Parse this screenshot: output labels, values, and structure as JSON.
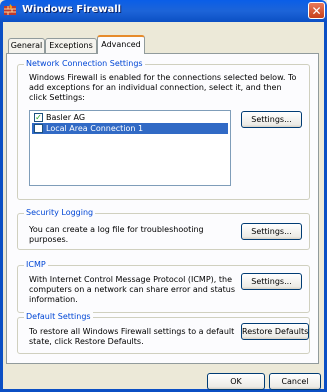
{
  "window": {
    "title": "Windows Firewall",
    "close_glyph": "✕"
  },
  "tabs": [
    {
      "label": "General"
    },
    {
      "label": "Exceptions"
    },
    {
      "label": "Advanced"
    }
  ],
  "network": {
    "group_title": "Network Connection Settings",
    "description": "Windows Firewall is enabled for the connections selected below. To add exceptions for an individual connection, select it, and then click Settings:",
    "connections": [
      {
        "label": "Basler AG",
        "checked": true,
        "selected": false
      },
      {
        "label": "Local Area Connection 1",
        "checked": false,
        "selected": true
      }
    ],
    "settings_button": "Settings..."
  },
  "security_logging": {
    "group_title": "Security Logging",
    "description": "You can create a log file for troubleshooting purposes.",
    "settings_button": "Settings..."
  },
  "icmp": {
    "group_title": "ICMP",
    "description": "With Internet Control Message Protocol (ICMP), the computers on a network can share error and status information.",
    "settings_button": "Settings..."
  },
  "defaults": {
    "group_title": "Default Settings",
    "description": "To restore all Windows Firewall settings to a default state, click Restore Defaults.",
    "restore_button": "Restore Defaults"
  },
  "footer": {
    "ok_button": "OK",
    "cancel_button": "Cancel"
  },
  "colors": {
    "titlebar": "#0a5ee8",
    "group_title": "#0046d5",
    "selection": "#316ac5",
    "tab_highlight": "#e68b2c"
  }
}
